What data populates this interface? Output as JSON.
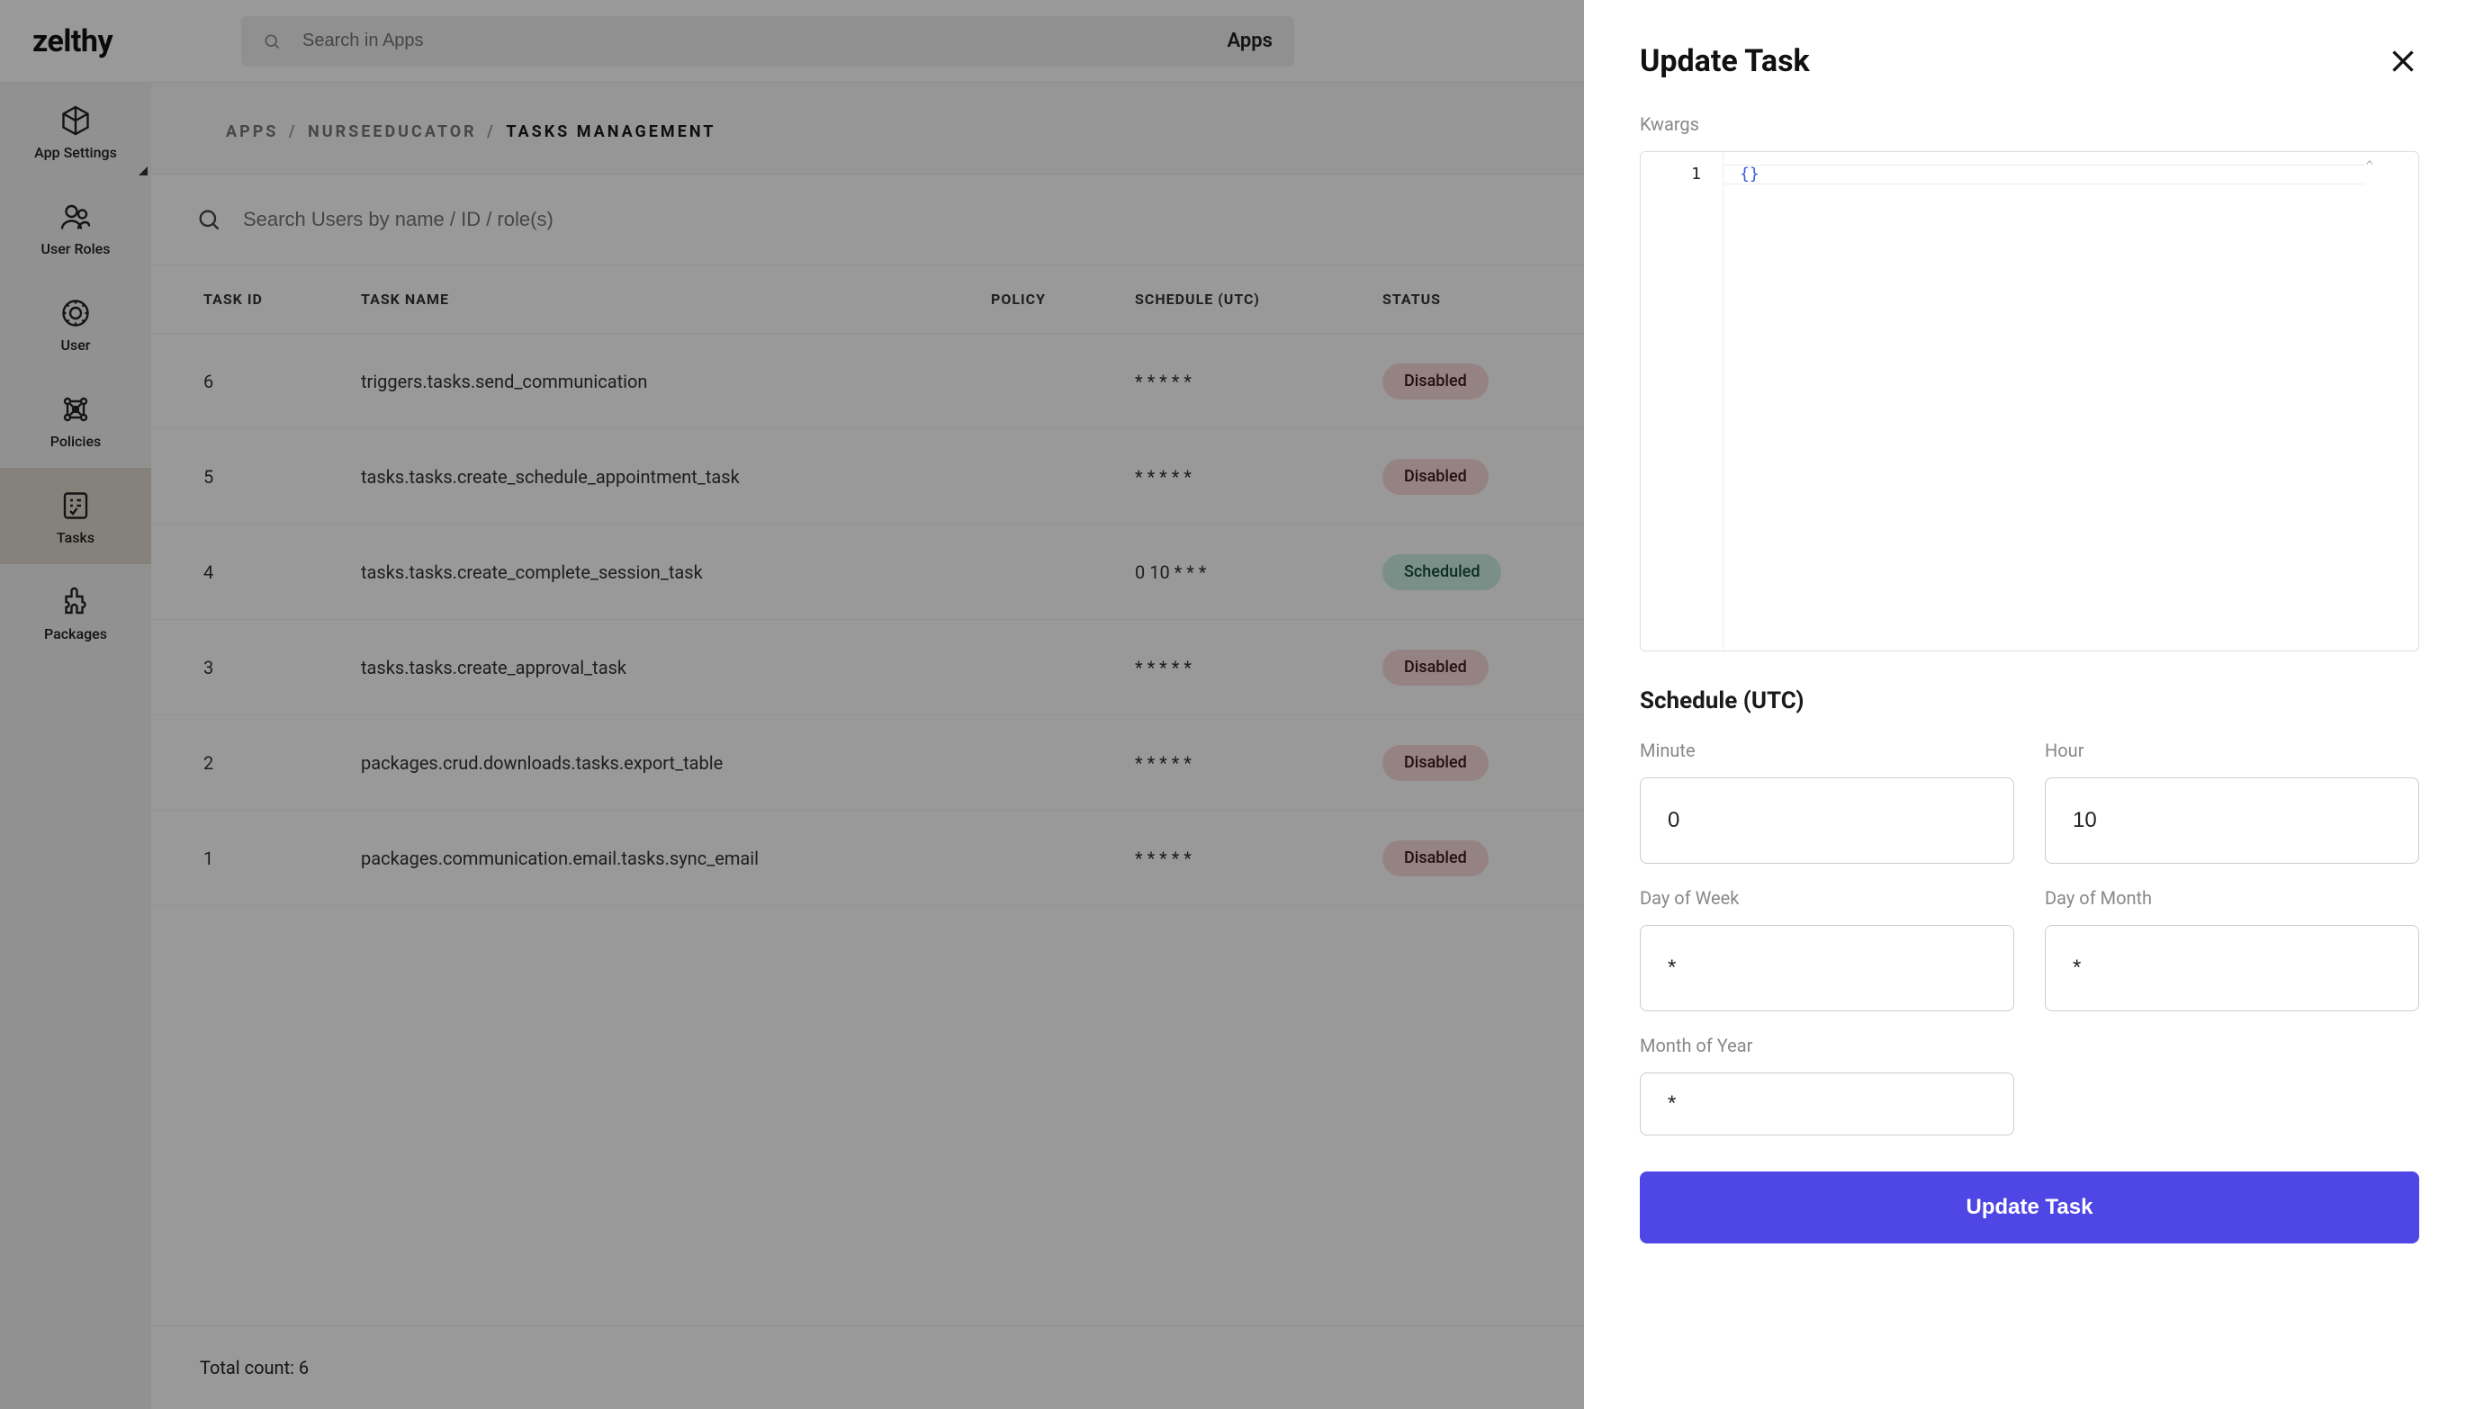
{
  "brand": "zelthy",
  "topsearch": {
    "placeholder": "Search in Apps",
    "apps_label": "Apps"
  },
  "sidebar": {
    "items": [
      {
        "label": "App Settings"
      },
      {
        "label": "User Roles"
      },
      {
        "label": "User"
      },
      {
        "label": "Policies"
      },
      {
        "label": "Tasks"
      },
      {
        "label": "Packages"
      }
    ]
  },
  "breadcrumbs": {
    "a": "APPS",
    "b": "NURSEEDUCATOR",
    "c": "TASKS MANAGEMENT",
    "sep": "/"
  },
  "usersearch": {
    "placeholder": "Search Users by name / ID / role(s)"
  },
  "columns": {
    "id": "TASK ID",
    "name": "TASK NAME",
    "policy": "POLICY",
    "sched": "SCHEDULE (UTC)",
    "status": "STATUS"
  },
  "rows": [
    {
      "id": "6",
      "name": "triggers.tasks.send_communication",
      "sched": "* * * * *",
      "status": "Disabled",
      "kind": "disabled"
    },
    {
      "id": "5",
      "name": "tasks.tasks.create_schedule_appointment_task",
      "sched": "* * * * *",
      "status": "Disabled",
      "kind": "disabled"
    },
    {
      "id": "4",
      "name": "tasks.tasks.create_complete_session_task",
      "sched": "0 10 * * *",
      "status": "Scheduled",
      "kind": "scheduled"
    },
    {
      "id": "3",
      "name": "tasks.tasks.create_approval_task",
      "sched": "* * * * *",
      "status": "Disabled",
      "kind": "disabled"
    },
    {
      "id": "2",
      "name": "packages.crud.downloads.tasks.export_table",
      "sched": "* * * * *",
      "status": "Disabled",
      "kind": "disabled"
    },
    {
      "id": "1",
      "name": "packages.communication.email.tasks.sync_email",
      "sched": "* * * * *",
      "status": "Disabled",
      "kind": "disabled"
    }
  ],
  "footer": {
    "total_label": "Total count: ",
    "total_value": "6"
  },
  "panel": {
    "title": "Update Task",
    "kwargs_label": "Kwargs",
    "code_line_num": "1",
    "code_text": "{}",
    "schedule_title": "Schedule (UTC)",
    "fields": {
      "minute": {
        "label": "Minute",
        "value": "0"
      },
      "hour": {
        "label": "Hour",
        "value": "10"
      },
      "dow": {
        "label": "Day of Week",
        "value": "*"
      },
      "dom": {
        "label": "Day of Month",
        "value": "*"
      },
      "moy": {
        "label": "Month of Year",
        "value": "*"
      }
    },
    "submit": "Update Task"
  }
}
